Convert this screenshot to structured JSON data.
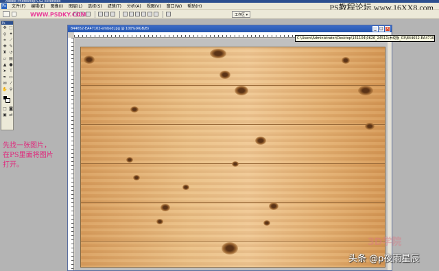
{
  "app": {
    "title": "Adobe Photoshop CS2 Extended"
  },
  "watermark_top": "PS教程论坛 www.16XX8.com",
  "menu": [
    "文件(F)",
    "编辑(E)",
    "图像(I)",
    "图层(L)",
    "选择(S)",
    "滤镜(T)",
    "分析(A)",
    "视图(V)",
    "窗口(W)",
    "帮助(H)"
  ],
  "options_bar": {
    "url_overlay": "WWW.PSDKY.COM",
    "workspace_label": "工作区"
  },
  "toolbox": {
    "header": "Ps"
  },
  "annotation": "先找一张图片，\n在PS里面将图片\n打开。",
  "document": {
    "title": "844652-EA47102-embed.jpg @ 100%(RGB/8)",
    "path_tooltip": "C:\\Users\\Administrator\\Desktop\\141104\\0626_24511\\木纹板_03\\844652-EA47102-embed.jpg"
  },
  "overlays": {
    "logo_3d": "3D学院",
    "credit": "头条 @p夜雨星辰"
  },
  "colors": {
    "accent_pink": "#e0287c",
    "title_blue": "#2c4f8f"
  }
}
